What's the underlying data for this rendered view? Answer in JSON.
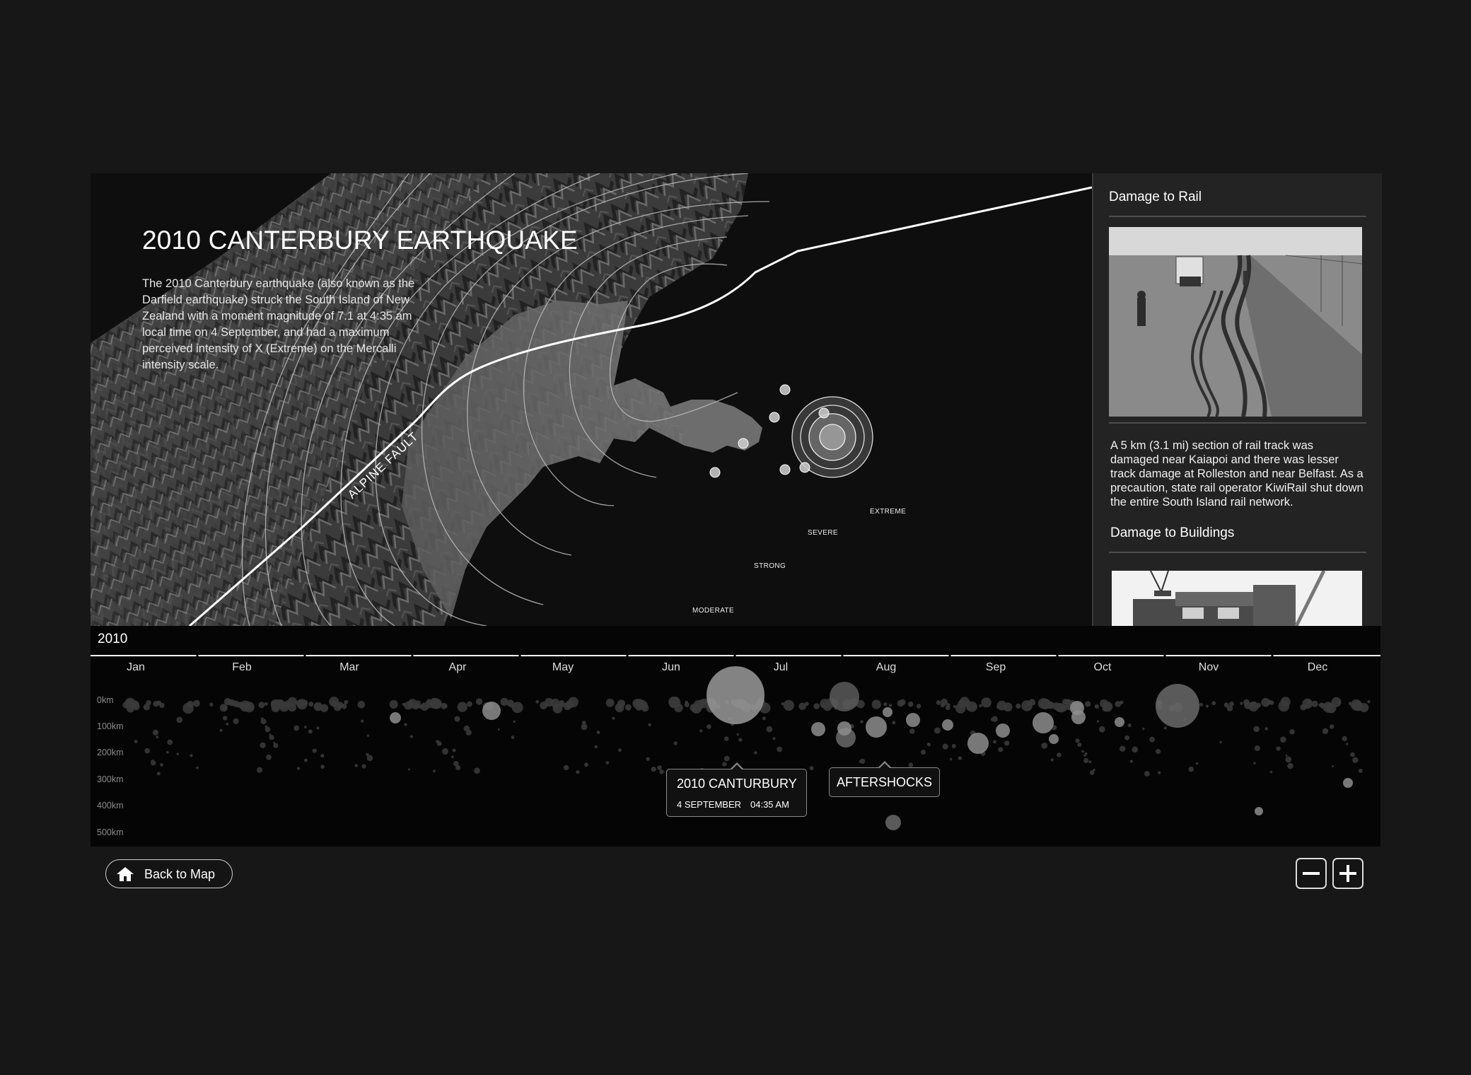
{
  "map": {
    "title": "2010 CANTERBURY EARTHQUAKE",
    "description": "The 2010 Canterbury earthquake (also known as the Darfield earthquake) struck the South Island of New Zealand with a moment magnitude of 7.1 at 4:35 am local time on 4 September, and had a maximum perceived intensity of X (Extreme) on the Mercalli intensity scale.",
    "fault_label": "ALPINE FAULT",
    "intensity_labels": {
      "extreme": "EXTREME",
      "severe": "SEVERE",
      "strong": "STRONG",
      "moderate": "MODERATE"
    }
  },
  "side_panel": {
    "rail": {
      "heading": "Damage to Rail",
      "text": "A 5 km (3.1 mi) section of rail track was damaged near Kaiapoi and there was lesser track damage at Rolleston and near Belfast. As a precaution, state rail operator KiwiRail shut down the entire South Island rail network."
    },
    "buildings": {
      "heading": "Damage to Buildings"
    }
  },
  "timeline": {
    "year": "2010",
    "months": [
      "Jan",
      "Feb",
      "Mar",
      "Apr",
      "May",
      "Jun",
      "Jul",
      "Aug",
      "Sep",
      "Oct",
      "Nov",
      "Dec"
    ],
    "depth_labels": [
      "0km",
      "100km",
      "200km",
      "300km",
      "400km",
      "500km"
    ],
    "main_event": {
      "title": "2010 CANTURBURY",
      "date": "4 SEPTEMBER",
      "time": "04:35 AM"
    },
    "aftershocks_label": "AFTERSHOCKS"
  },
  "footer": {
    "back_label": "Back to Map"
  },
  "icons": {
    "home": "home-icon",
    "zoom_out": "minus-icon",
    "zoom_in": "plus-icon"
  }
}
